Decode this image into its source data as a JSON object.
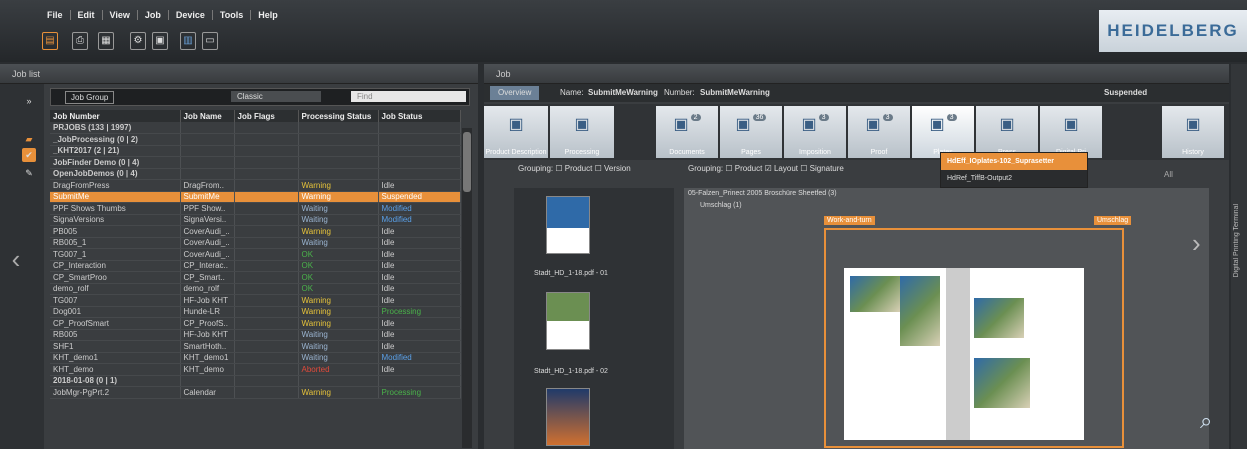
{
  "menu": [
    "File",
    "Edit",
    "View",
    "Job",
    "Device",
    "Tools",
    "Help"
  ],
  "logo": "HEIDELBERG",
  "left": {
    "title": "Job list",
    "filter": {
      "group": "Job Group",
      "view": "Classic",
      "search": "Find"
    },
    "columns": [
      "Job Number",
      "Job Name",
      "Job Flags",
      "Processing Status",
      "Job Status"
    ],
    "rows": [
      [
        "PRJOBS (133 | 1997)",
        "",
        "",
        "",
        ""
      ],
      [
        "_JobProcessing (0 | 2)",
        "",
        "",
        "",
        ""
      ],
      [
        "_KHT2017 (2 | 21)",
        "",
        "",
        "",
        ""
      ],
      [
        "JobFinder Demo (0 | 4)",
        "",
        "",
        "",
        ""
      ],
      [
        "OpenJobDemos (0 | 4)",
        "",
        "",
        "",
        ""
      ],
      [
        "DragFromPress",
        "DragFrom..",
        "",
        "Warning",
        "Idle"
      ],
      [
        "SubmitMe",
        "SubmitMe",
        "",
        "Warning",
        "Suspended"
      ],
      [
        "PPF Shows Thumbs",
        "PPF Show..",
        "",
        "Waiting",
        "Modified"
      ],
      [
        "SignaVersions",
        "SignaVersi..",
        "",
        "Waiting",
        "Modified"
      ],
      [
        "PB005",
        "CoverAudi_..",
        "",
        "Warning",
        "Idle"
      ],
      [
        "RB005_1",
        "CoverAudi_..",
        "",
        "Waiting",
        "Idle"
      ],
      [
        "TG007_1",
        "CoverAudi_..",
        "",
        "OK",
        "Idle"
      ],
      [
        "CP_Interaction",
        "CP_Interac..",
        "",
        "OK",
        "Idle"
      ],
      [
        "CP_SmartProo",
        "CP_Smart..",
        "",
        "OK",
        "Idle"
      ],
      [
        "demo_rolf",
        "demo_rolf",
        "",
        "OK",
        "Idle"
      ],
      [
        "TG007",
        "HF-Job KHT",
        "",
        "Warning",
        "Idle"
      ],
      [
        "Dog001",
        "Hunde-LR",
        "",
        "Warning",
        "Processing"
      ],
      [
        "CP_ProofSmart",
        "CP_ProofS..",
        "",
        "Warning",
        "Idle"
      ],
      [
        "RB005",
        "HF-Job KHT",
        "",
        "Waiting",
        "Idle"
      ],
      [
        "SHF1",
        "SmartHoth..",
        "",
        "Waiting",
        "Idle"
      ],
      [
        "KHT_demo1",
        "KHT_demo1",
        "",
        "Waiting",
        "Modified"
      ],
      [
        "KHT_demo",
        "KHT_demo",
        "",
        "Aborted",
        "Idle"
      ],
      [
        "2018-01-08 (0 | 1)",
        "",
        "",
        "",
        ""
      ],
      [
        "JobMgr-PgPrt.2",
        "Calendar",
        "",
        "Warning",
        "Processing"
      ]
    ]
  },
  "right": {
    "title": "Job",
    "overview": "Overview",
    "name_label": "Name:",
    "name": "SubmitMeWarning",
    "number_label": "Number:",
    "number": "SubmitMeWarning",
    "status": "Suspended",
    "tabs": [
      {
        "label": "Product Description"
      },
      {
        "label": "Processing"
      },
      {
        "label": "Documents",
        "badge": "2"
      },
      {
        "label": "Pages",
        "badge": "36"
      },
      {
        "label": "Imposition",
        "badge": "3"
      },
      {
        "label": "Proof",
        "badge": "3"
      },
      {
        "label": "Plates",
        "badge": "3"
      },
      {
        "label": "Press"
      },
      {
        "label": "Digital Pri"
      },
      {
        "label": "History"
      }
    ],
    "grouping_label": "Grouping:",
    "pages_group": [
      "Product",
      "Version"
    ],
    "layout_group": [
      "Product",
      "Layout",
      "Signature"
    ],
    "pages": [
      "Stadt_HD_1-18.pdf - 01",
      "Stadt_HD_1-18.pdf - 02"
    ],
    "tree": [
      "05-Falzen_Prinect 2005 Broschüre Sheetfed (3)",
      "Umschlag (1)"
    ],
    "sheet_tags": [
      "Work-and-turn",
      "Umschlag"
    ],
    "dropdown": [
      "HdEff_IOplates-102_Suprasetter",
      "HdRef_TiffB-Output2"
    ],
    "all": "All",
    "vertical": "Digital Printing Terminal"
  }
}
